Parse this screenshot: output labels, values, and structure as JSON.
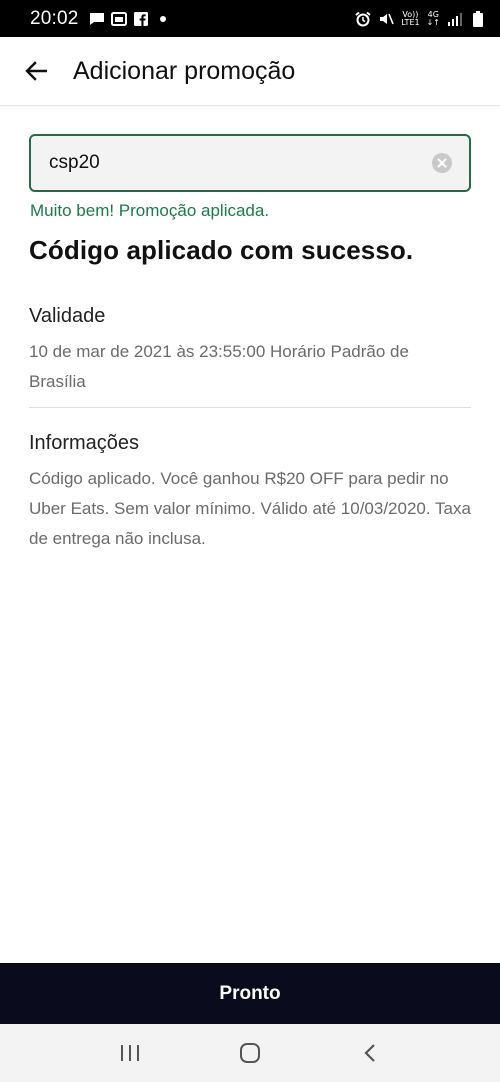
{
  "status_bar": {
    "time": "20:02",
    "left_icons": [
      "message-icon",
      "image-icon",
      "facebook-icon",
      "dot-icon"
    ],
    "right_icons": [
      "alarm-icon",
      "mute-icon",
      "volte-icon",
      "4g-icon",
      "signal-icon",
      "battery-icon"
    ],
    "volte_top": "Vo))",
    "volte_bottom": "LTE1",
    "net_top": "4G",
    "net_bottom": "↓↑"
  },
  "app_bar": {
    "title": "Adicionar promoção",
    "back_icon": "arrow-left-icon"
  },
  "promo": {
    "value": "csp20",
    "success_message": "Muito bem! Promoção aplicada.",
    "heading": "Código aplicado com sucesso."
  },
  "validity": {
    "title": "Validade",
    "text": "10 de mar de 2021 às 23:55:00 Horário Padrão de Brasília"
  },
  "info": {
    "title": "Informações",
    "text": "Código aplicado. Você ganhou R$20 OFF para pedir no Uber Eats. Sem valor mínimo. Válido até 10/03/2020. Taxa de entrega não inclusa."
  },
  "done_button": "Pronto",
  "nav_bar": {
    "icons": [
      "recent-apps-icon",
      "home-icon",
      "back-icon"
    ]
  },
  "colors": {
    "accent_green": "#276a4a",
    "success_green": "#1d7a4b",
    "button_dark": "#0b0b1e"
  }
}
